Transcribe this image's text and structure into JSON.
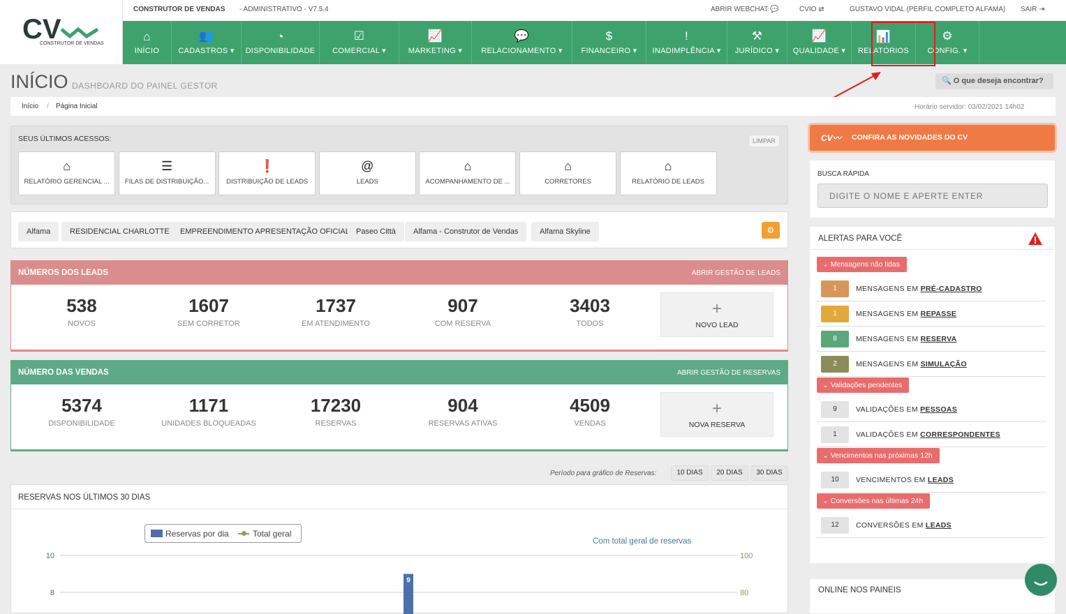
{
  "app": {
    "name": "CONSTRUTOR DE VENDAS",
    "subtitle": "- ADMINISTRATIVO - V7.5.4",
    "logo_text": "CONSTRUTOR DE VENDAS"
  },
  "topbar": {
    "webchat": "ABRIR WEBCHAT",
    "cvio": "CVIO",
    "user": "GUSTAVO VIDAL (PERFIL COMPLETO ALFAMA)",
    "logout": "SAIR"
  },
  "nav": [
    {
      "label": "INÍCIO",
      "icon": "home-icon",
      "glyph": "⌂"
    },
    {
      "label": "CADASTROS ▾",
      "icon": "users-icon",
      "glyph": "👥"
    },
    {
      "label": "DISPONIBILIDADE",
      "icon": "dashboard-icon",
      "glyph": "◔"
    },
    {
      "label": "COMERCIAL ▾",
      "icon": "check-icon",
      "glyph": "☑"
    },
    {
      "label": "MARKETING ▾",
      "icon": "chart-line-icon",
      "glyph": "📈"
    },
    {
      "label": "RELACIONAMENTO ▾",
      "icon": "chat-icon",
      "glyph": "💬"
    },
    {
      "label": "FINANCEIRO ▾",
      "icon": "dollar-icon",
      "glyph": "$"
    },
    {
      "label": "INADIMPLÊNCIA ▾",
      "icon": "alert-icon",
      "glyph": "!"
    },
    {
      "label": "JURÍDICO ▾",
      "icon": "gavel-icon",
      "glyph": "⚒"
    },
    {
      "label": "QUALIDADE ▾",
      "icon": "chart-area-icon",
      "glyph": "📈"
    },
    {
      "label": "RELATÓRIOS",
      "icon": "bar-chart-icon",
      "glyph": "📊"
    },
    {
      "label": "CONFIG. ▾",
      "icon": "gear-icon",
      "glyph": "⚙"
    }
  ],
  "page": {
    "title": "INÍCIO",
    "subtitle": "DASHBOARD DO PAINEL GESTOR",
    "search_btn": "O que deseja encontrar?",
    "breadcrumb_home": "Início",
    "breadcrumb_sep": "/",
    "breadcrumb_current": "Página Inicial",
    "server_time": "Horário servidor: 03/02/2021 14h02"
  },
  "recent": {
    "title": "SEUS ÚLTIMOS ACESSOS:",
    "clear": "LIMPAR",
    "items": [
      {
        "label": "RELATÓRIO GERENCIAL ...",
        "glyph": "⌂"
      },
      {
        "label": "FILAS DE DISTRIBUIÇÃO...",
        "glyph": "☰"
      },
      {
        "label": "DISTRIBUIÇÃO DE LEADS",
        "glyph": "❗"
      },
      {
        "label": "LEADS",
        "glyph": "@"
      },
      {
        "label": "ACOMPANHAMENTO DE ...",
        "glyph": "⌂"
      },
      {
        "label": "CORRETORES",
        "glyph": "⌂"
      },
      {
        "label": "RELATÓRIO DE LEADS",
        "glyph": "⌂"
      }
    ]
  },
  "projects": [
    "Alfama",
    "RESIDENCIAL CHARLOTTE",
    "EMPREENDIMENTO APRESENTAÇÃO OFICIAL",
    "Paseo Città",
    "Alfama - Construtor de Vendas",
    "Alfama Skyline"
  ],
  "leads": {
    "title": "NÚMEROS DOS LEADS",
    "link": "ABRIR GESTÃO DE LEADS",
    "stats": [
      {
        "n": "538",
        "l": "NOVOS"
      },
      {
        "n": "1607",
        "l": "SEM CORRETOR"
      },
      {
        "n": "1737",
        "l": "EM ATENDIMENTO"
      },
      {
        "n": "907",
        "l": "COM RESERVA"
      },
      {
        "n": "3403",
        "l": "TODOS"
      }
    ],
    "new_btn": "NOVO LEAD"
  },
  "sales": {
    "title": "NÚMERO DAS VENDAS",
    "link": "ABRIR GESTÃO DE RESERVAS",
    "stats": [
      {
        "n": "5374",
        "l": "DISPONIBILIDADE"
      },
      {
        "n": "1171",
        "l": "UNIDADES BLOQUEADAS"
      },
      {
        "n": "17230",
        "l": "RESERVAS"
      },
      {
        "n": "904",
        "l": "RESERVAS ATIVAS"
      },
      {
        "n": "4509",
        "l": "VENDAS"
      }
    ],
    "new_btn": "NOVA RESERVA"
  },
  "period": {
    "label": "Período para gráfico de Reservas:",
    "options": [
      "10 DIAS",
      "20 DIAS",
      "30 DIAS"
    ]
  },
  "chart_data": {
    "type": "bar",
    "title": "RESERVAS NOS ÚLTIMOS 30 DIAS",
    "subtitle": "Com total geral de reservas",
    "legend": [
      "Reservas por dia",
      "Total geral"
    ],
    "legend_placement": "top",
    "y_ticks": [
      10,
      8
    ],
    "y2_ticks": [
      100,
      80
    ],
    "series": [
      {
        "name": "Reservas por dia",
        "values": [
          9
        ]
      }
    ],
    "data_labels": [
      "9"
    ],
    "grid": true
  },
  "sidebar": {
    "news": "CONFIRA AS NOVIDADES DO CV",
    "quick_title": "BUSCA RÁPIDA",
    "quick_placeholder": "DIGITE O NOME E APERTE ENTER",
    "alerts_title": "ALERTAS PARA VOCÊ",
    "online_title": "ONLINE NOS PAINEIS"
  },
  "alerts": [
    {
      "tag": "Mensagens não lidas",
      "rows": [
        {
          "count": "1",
          "text": "MENSAGENS EM",
          "link": "PRÉ-CADASTRO",
          "color": "#d8955a"
        },
        {
          "count": "1",
          "text": "MENSAGENS EM",
          "link": "REPASSE",
          "color": "#e1a93c"
        },
        {
          "count": "8",
          "text": "MENSAGENS EM",
          "link": "RESERVA",
          "color": "#5aa87a"
        },
        {
          "count": "2",
          "text": "MENSAGENS EM",
          "link": "SIMULAÇÃO",
          "color": "#8c8c5a"
        }
      ]
    },
    {
      "tag": "Validações pendentes",
      "rows": [
        {
          "count": "9",
          "text": "VALIDAÇÕES EM",
          "link": "PESSOAS",
          "color": "#e3e3e3"
        },
        {
          "count": "1",
          "text": "VALIDAÇÕES EM",
          "link": "CORRESPONDENTES",
          "color": "#e3e3e3"
        }
      ]
    },
    {
      "tag": "Vencimentos nas próximas 12h",
      "rows": [
        {
          "count": "10",
          "text": "VENCIMENTOS EM",
          "link": "LEADS",
          "color": "#e3e3e3"
        }
      ]
    },
    {
      "tag": "Conversões nas últimas 24h",
      "rows": [
        {
          "count": "12",
          "text": "CONVERSÕES EM",
          "link": "LEADS",
          "color": "#e3e3e3"
        }
      ]
    }
  ]
}
